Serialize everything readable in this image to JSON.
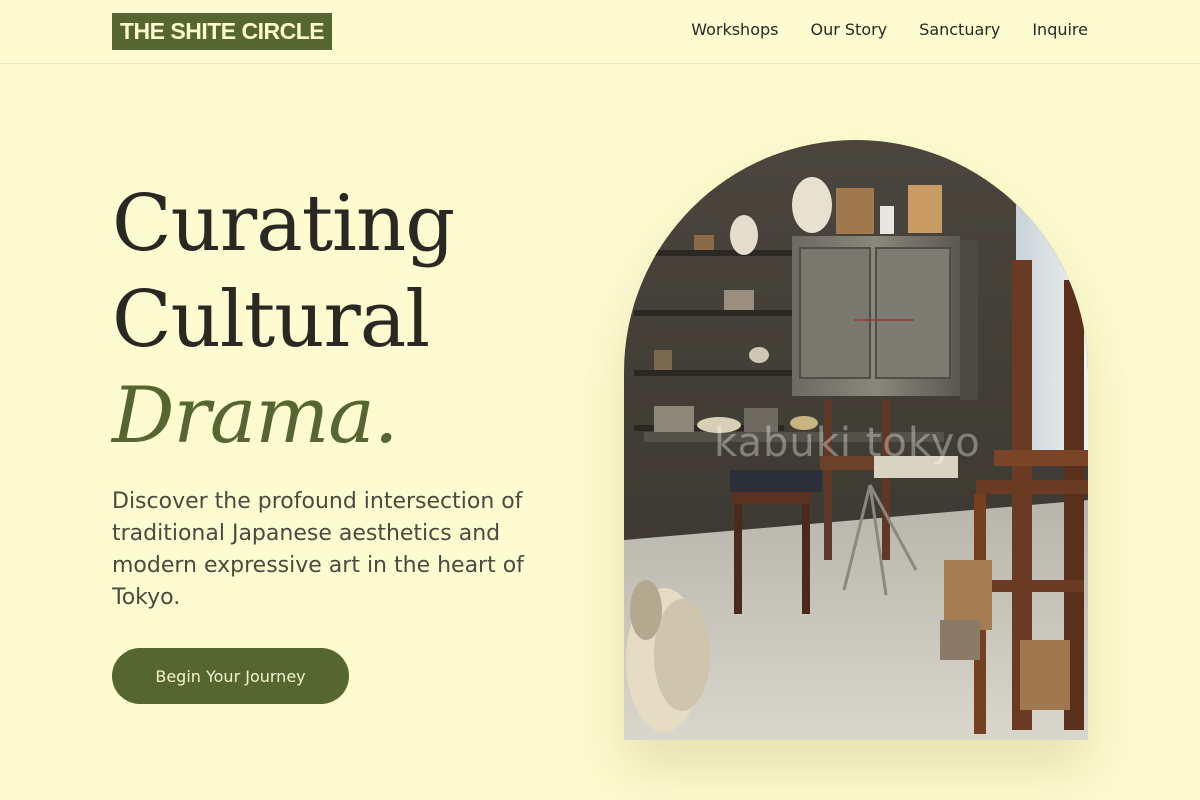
{
  "brand": {
    "name": "THE SHITE CIRCLE"
  },
  "nav": {
    "items": [
      {
        "label": "Workshops"
      },
      {
        "label": "Our Story"
      },
      {
        "label": "Sanctuary"
      },
      {
        "label": "Inquire"
      }
    ]
  },
  "hero": {
    "title_line1": "Curating",
    "title_line2": "Cultural",
    "title_accent": "Drama.",
    "description": "Discover the profound intersection of traditional Japanese aesthetics and modern expressive art in the heart of Tokyo.",
    "cta_label": "Begin Your Journey",
    "image": {
      "subject": "cluttered artist studio with wooden chairs, shelves and a metal kiln",
      "watermark": "kabuki tokyo"
    }
  },
  "colors": {
    "background": "#fdfbcf",
    "accent": "#566630",
    "text": "#2a2822"
  }
}
